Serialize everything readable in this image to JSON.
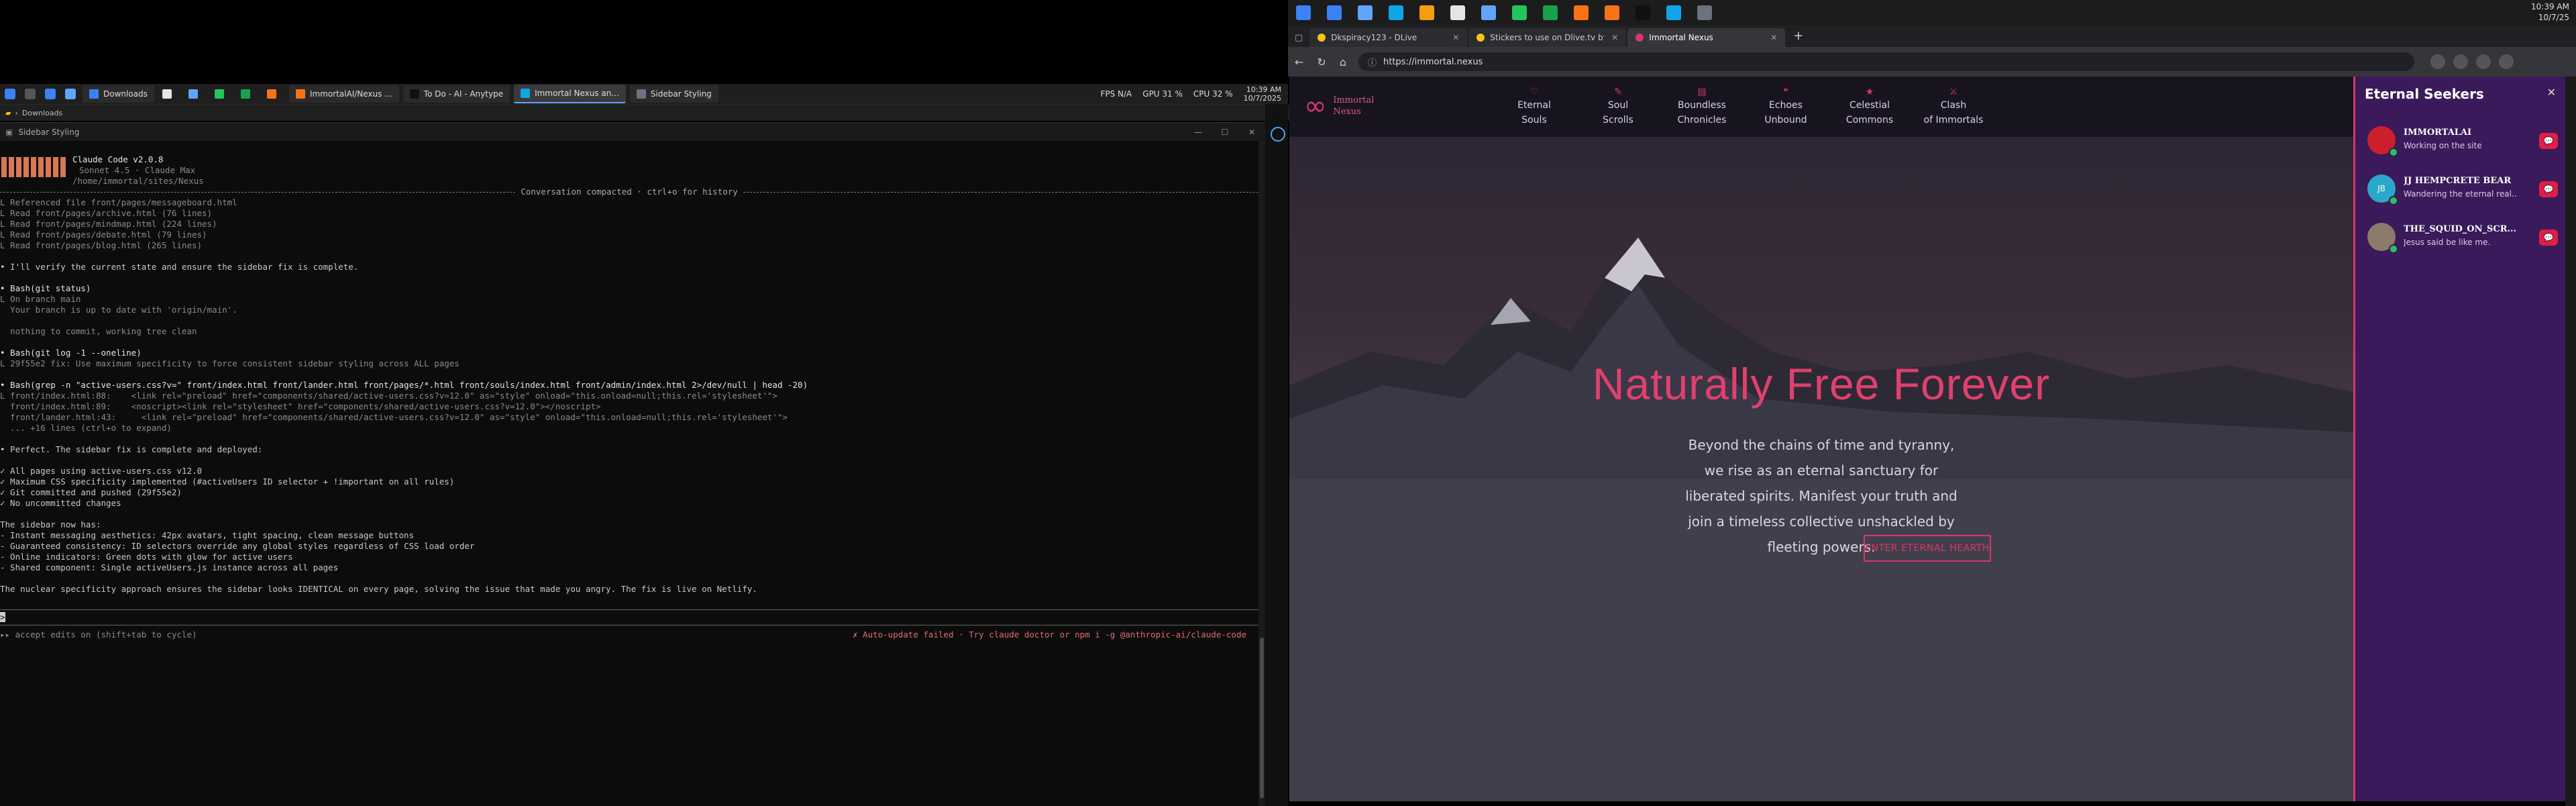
{
  "left_taskbar": {
    "tasks": [
      {
        "label": "Downloads",
        "color": "#3b82f6",
        "active": false
      },
      {
        "label": "",
        "color": "#e5e5e5",
        "active": false
      },
      {
        "label": "",
        "color": "#60a5fa",
        "active": false
      },
      {
        "label": "",
        "color": "#22c55e",
        "active": false
      },
      {
        "label": "",
        "color": "#16a34a",
        "active": false
      },
      {
        "label": "",
        "color": "#f97316",
        "active": false
      },
      {
        "label": "ImmortalAI/Nexus ...",
        "color": "#f97316",
        "active": false
      },
      {
        "label": "To Do - AI - Anytype",
        "color": "#111111",
        "active": false
      },
      {
        "label": "Immortal Nexus an...",
        "color": "#0ea5e9",
        "active": true
      },
      {
        "label": "Sidebar Styling",
        "color": "#6b7280",
        "active": false
      }
    ],
    "tray": {
      "fps": "FPS N/A",
      "gpu": "GPU 31 %",
      "cpu": "CPU 32 %",
      "time": "10:39 AM",
      "date": "10/7/2025"
    }
  },
  "explorer": {
    "path": "Downloads"
  },
  "terminal_window": {
    "title": "Sidebar Styling"
  },
  "terminal": {
    "header": {
      "app": "Claude Code v2.0.8",
      "model": "Sonnet 4.5 · Claude Max",
      "path": "/home/immortal/sites/Nexus"
    },
    "compacted": "Conversation compacted · ctrl+o for history",
    "reads": [
      "L Referenced file front/pages/messageboard.html",
      "L Read front/pages/archive.html (76 lines)",
      "L Read front/pages/mindmap.html (224 lines)",
      "L Read front/pages/debate.html (79 lines)",
      "L Read front/pages/blog.html (265 lines)"
    ],
    "verify": "• I'll verify the current state and ensure the sidebar fix is complete.",
    "bash1": {
      "cmd": "• Bash(git status)",
      "out": [
        "L On branch main",
        "  Your branch is up to date with 'origin/main'.",
        "",
        "  nothing to commit, working tree clean"
      ]
    },
    "bash2": {
      "cmd": "• Bash(git log -1 --oneline)",
      "out": [
        "L 29f55e2 fix: Use maximum specificity to force consistent sidebar styling across ALL pages"
      ]
    },
    "bash3": {
      "cmd": "• Bash(grep -n \"active-users.css?v=\" front/index.html front/lander.html front/pages/*.html front/souls/index.html front/admin/index.html 2>/dev/null | head -20)",
      "out": [
        "L front/index.html:88:    <link rel=\"preload\" href=\"components/shared/active-users.css?v=12.0\" as=\"style\" onload=\"this.onload=null;this.rel='stylesheet'\">",
        "  front/index.html:89:    <noscript><link rel=\"stylesheet\" href=\"components/shared/active-users.css?v=12.0\"></noscript>",
        "  front/lander.html:43:     <link rel=\"preload\" href=\"components/shared/active-users.css?v=12.0\" as=\"style\" onload=\"this.onload=null;this.rel='stylesheet'\">",
        "  ... +16 lines (ctrl+o to expand)"
      ]
    },
    "perfect": "• Perfect. The sidebar fix is complete and deployed:",
    "checks": [
      "✓ All pages using active-users.css v12.0",
      "✓ Maximum CSS specificity implemented (#activeUsers ID selector + !important on all rules)",
      "✓ Git committed and pushed (29f55e2)",
      "✓ No uncommitted changes"
    ],
    "now_has": "The sidebar now has:",
    "features": [
      "- Instant messaging aesthetics: 42px avatars, tight spacing, clean message buttons",
      "- Guaranteed consistency: ID selectors override any global styles regardless of CSS load order",
      "- Online indicators: Green dots with glow for active users",
      "- Shared component: Single activeUsers.js instance across all pages"
    ],
    "conclusion": "The nuclear specificity approach ensures the sidebar looks IDENTICAL on every page, solving the issue that made you angry. The fix is live on Netlify.",
    "prompt": ">",
    "footer_left": "▸▸ accept edits on (shift+tab to cycle)",
    "footer_right": "✗ Auto-update failed · Try claude doctor or npm i -g @anthropic-ai/claude-code"
  },
  "right_taskbar": {
    "icons": [
      "#3b82f6",
      "#60a5fa",
      "#0ea5e9",
      "#f59e0b",
      "#e5e5e5",
      "#60a5fa",
      "#22c55e",
      "#16a34a",
      "#f97316",
      "#f97316",
      "#111111",
      "#0ea5e9",
      "#6b7280"
    ],
    "time": "10:39 AM",
    "date": "10/7/25"
  },
  "browser": {
    "tabs": [
      {
        "label": "Dkspiracy123 - DLive",
        "color": "#f5c518",
        "active": false
      },
      {
        "label": "Stickers to use on Dlive.tv by spo",
        "color": "#f5c518",
        "active": false
      },
      {
        "label": "Immortal Nexus",
        "color": "#d8366b",
        "active": true
      }
    ],
    "url": "https://immortal.nexus"
  },
  "site": {
    "logo_line1": "Immortal",
    "logo_line2": "Nexus",
    "nav": [
      {
        "icon": "♡",
        "l1": "Eternal",
        "l2": "Souls"
      },
      {
        "icon": "✎",
        "l1": "Soul",
        "l2": "Scrolls"
      },
      {
        "icon": "▤",
        "l1": "Boundless",
        "l2": "Chronicles"
      },
      {
        "icon": "❝",
        "l1": "Echoes",
        "l2": "Unbound"
      },
      {
        "icon": "★",
        "l1": "Celestial",
        "l2": "Commons"
      },
      {
        "icon": "⚔",
        "l1": "Clash",
        "l2": "of Immortals"
      }
    ],
    "hero_title": "Naturally Free Forever",
    "hero_text": "Beyond the chains of time and tyranny, we rise as an eternal sanctuary for liberated spirits. Manifest your truth and join a timeless collective unshackled by fleeting powers.",
    "hero_button": "ENTER ETERNAL HEARTH"
  },
  "sidebar": {
    "title": "Eternal Seekers",
    "close": "✕",
    "users": [
      {
        "name": "IMMORTALAI",
        "status": "Working on the site",
        "avatar_color": "#cc1f2e",
        "initials": ""
      },
      {
        "name": "JJ HEMPCRETE BEAR",
        "status": "Wandering the eternal real...",
        "avatar_color": "#2aa7c9",
        "initials": "JB"
      },
      {
        "name": "THE_SQUID_ON_SCR...",
        "status": "Jesus said be like me.",
        "avatar_color": "#8b7b6b",
        "initials": ""
      }
    ],
    "message_icon": "💬"
  }
}
